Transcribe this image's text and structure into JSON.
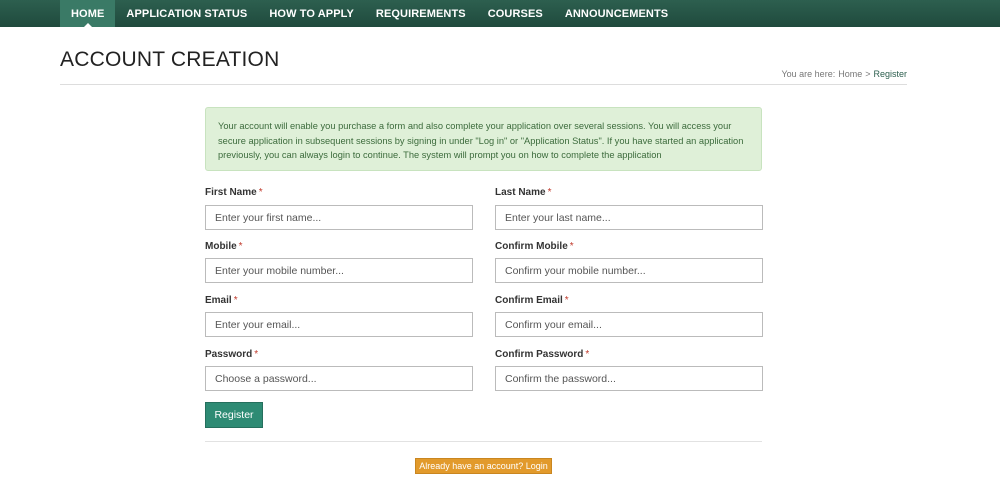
{
  "nav": {
    "items": [
      {
        "label": "HOME",
        "active": true
      },
      {
        "label": "APPLICATION STATUS",
        "active": false
      },
      {
        "label": "HOW TO APPLY",
        "active": false
      },
      {
        "label": "REQUIREMENTS",
        "active": false
      },
      {
        "label": "COURSES",
        "active": false
      },
      {
        "label": "ANNOUNCEMENTS",
        "active": false
      }
    ]
  },
  "page": {
    "title": "ACCOUNT CREATION"
  },
  "breadcrumb": {
    "prefix": "You are here:",
    "home": "Home",
    "separator": ">",
    "current": "Register"
  },
  "notice": {
    "text": "Your account will enable you purchase a form and also complete your application over several sessions. You will access your secure application in subsequent sessions by signing in under \"Log in\" or \"Application Status\". If you have started an application previously, you can always login to continue. The system will prompt you on how to complete the application"
  },
  "form": {
    "required_mark": "*",
    "first_name": {
      "label": "First Name",
      "placeholder": "Enter your first name...",
      "value": ""
    },
    "last_name": {
      "label": "Last Name",
      "placeholder": "Enter your last name...",
      "value": ""
    },
    "mobile": {
      "label": "Mobile",
      "placeholder": "Enter your mobile number...",
      "value": ""
    },
    "confirm_mobile": {
      "label": "Confirm Mobile",
      "placeholder": "Confirm your mobile number...",
      "value": ""
    },
    "email": {
      "label": "Email",
      "placeholder": "Enter your email...",
      "value": ""
    },
    "confirm_email": {
      "label": "Confirm Email",
      "placeholder": "Confirm your email...",
      "value": ""
    },
    "password": {
      "label": "Password",
      "placeholder": "Choose a password...",
      "value": ""
    },
    "confirm_password": {
      "label": "Confirm Password",
      "placeholder": "Confirm the password...",
      "value": ""
    },
    "register_label": "Register",
    "login_label": "Already have an account? Login"
  },
  "colors": {
    "nav_bg": "#1f4a3d",
    "nav_active": "#3a7a66",
    "register_button": "#2e8b74",
    "login_button": "#e29a2b",
    "notice_bg": "#dff0d8"
  }
}
